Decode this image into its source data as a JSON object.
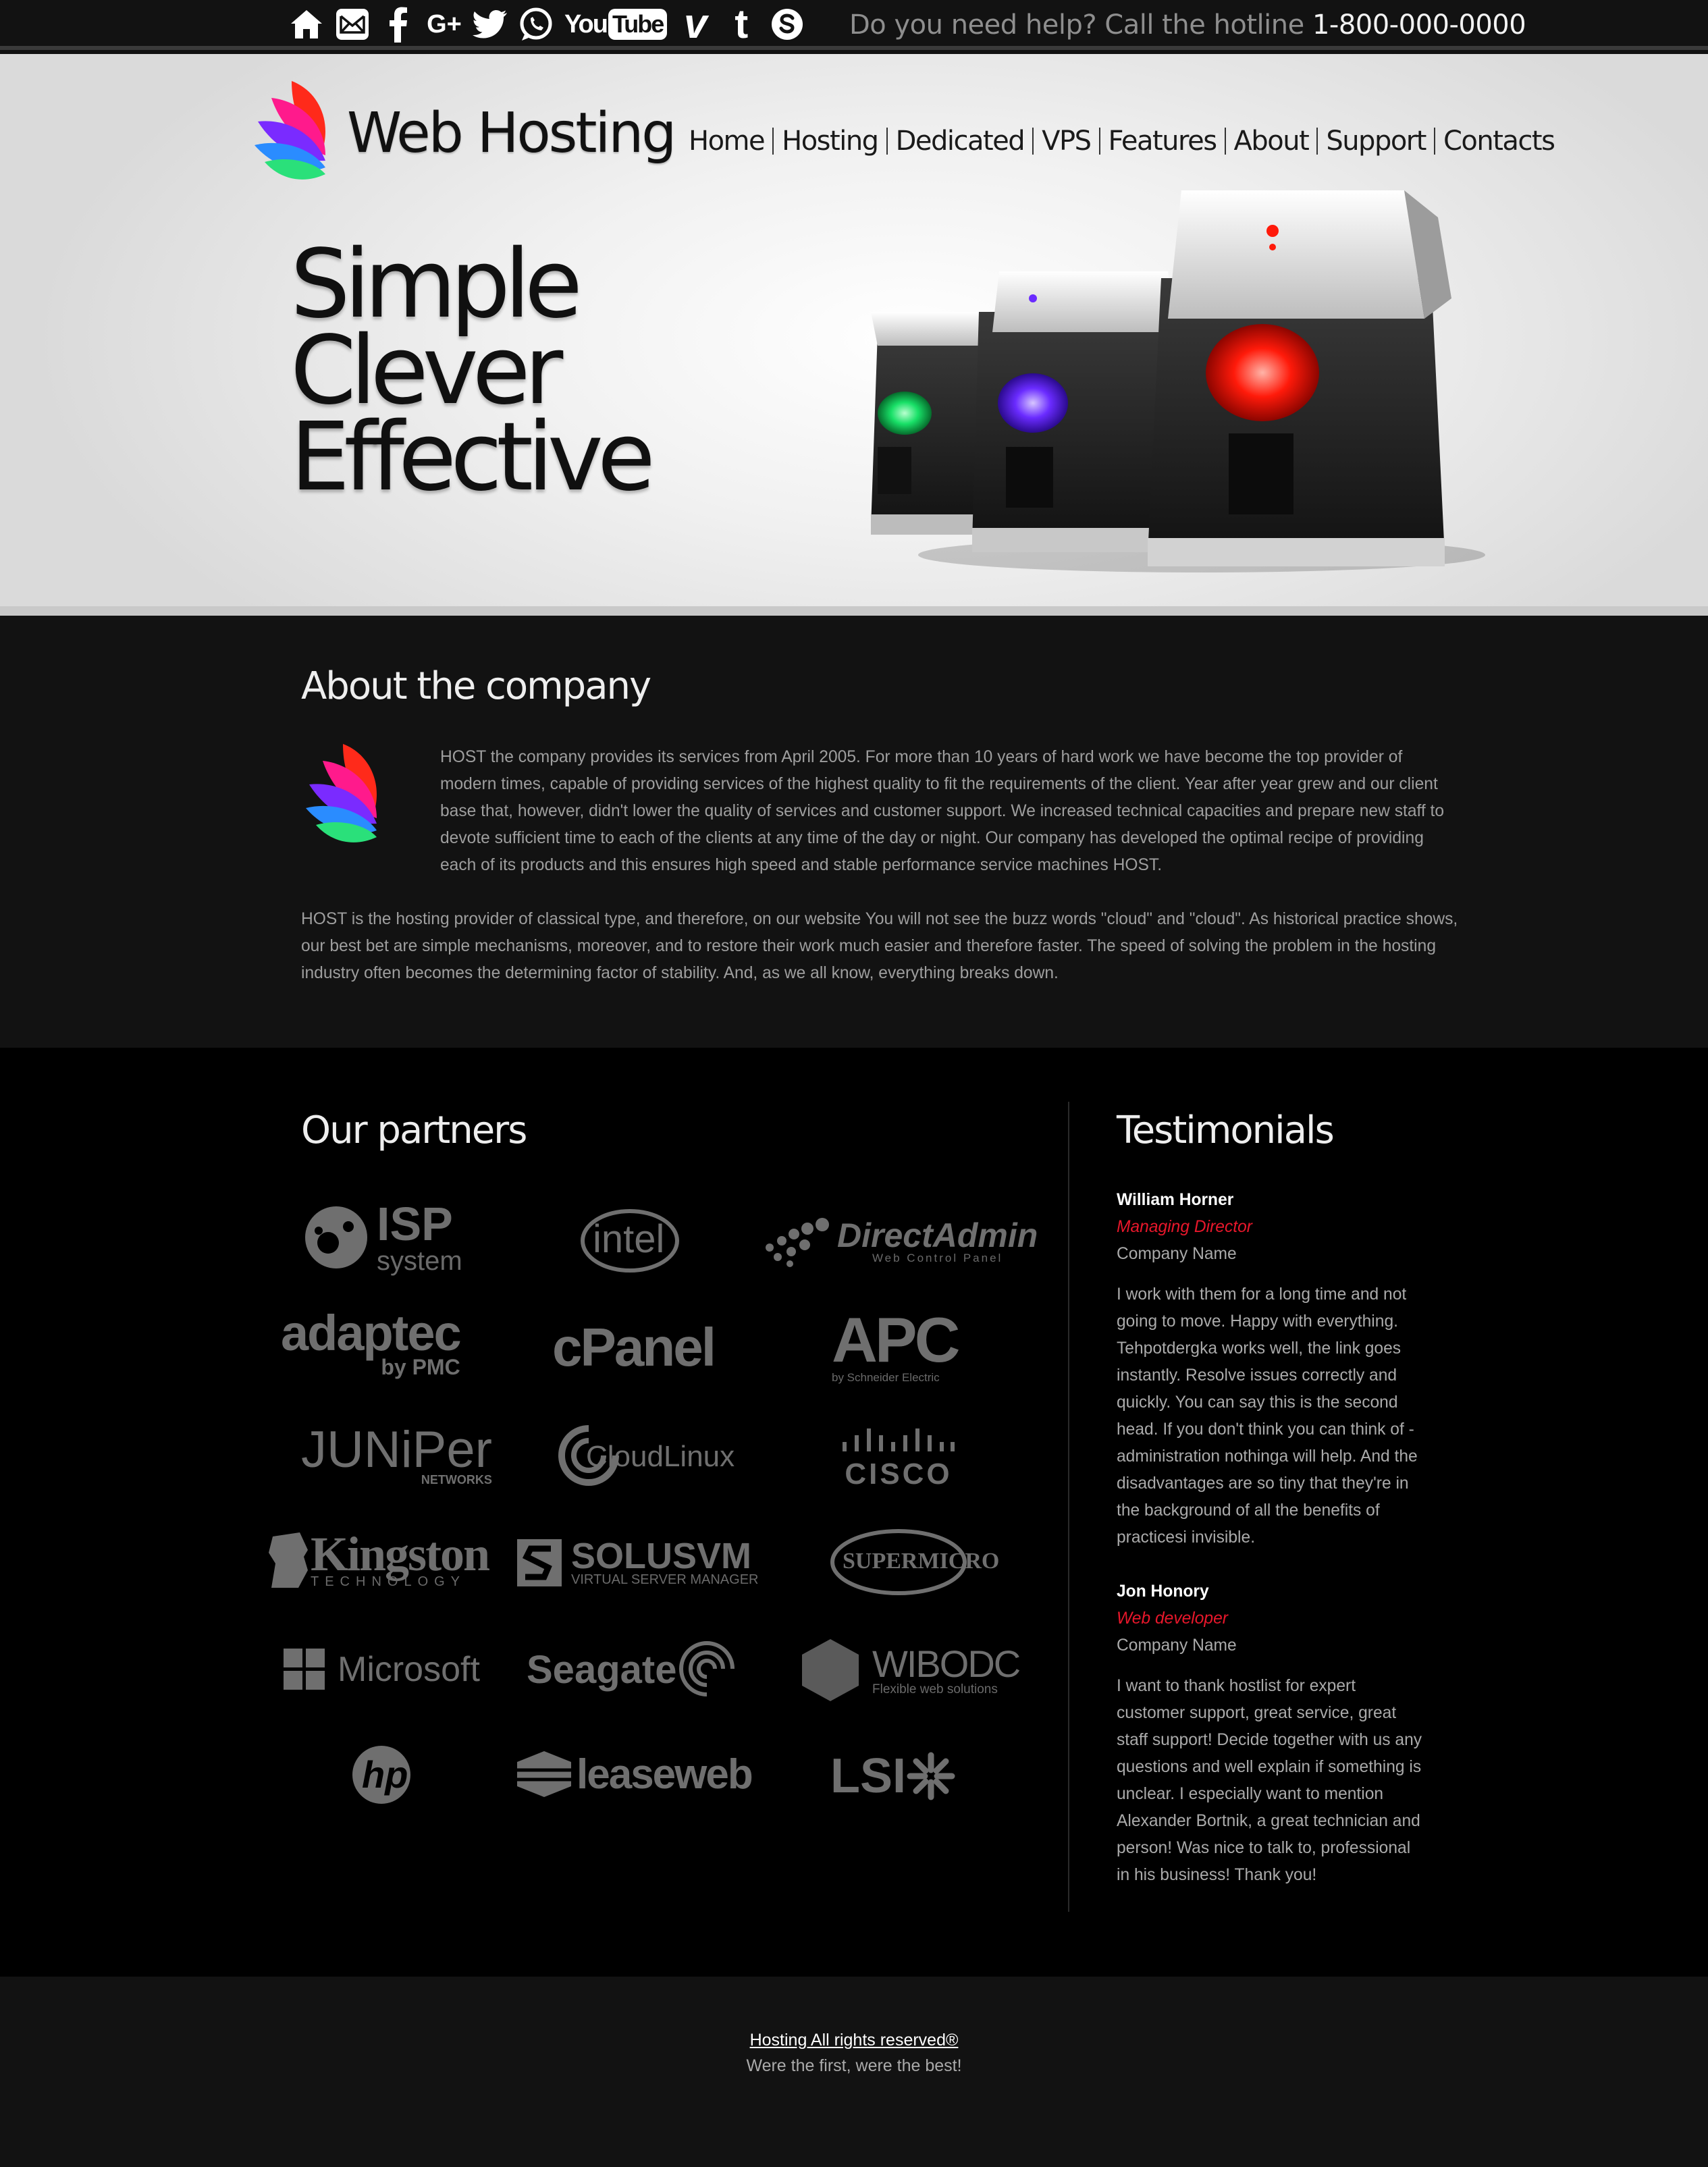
{
  "topbar": {
    "social_icons": [
      "home-icon",
      "mail-icon",
      "facebook-icon",
      "google-plus-icon",
      "twitter-icon",
      "whatsapp-icon",
      "youtube-icon",
      "vimeo-icon",
      "tumblr-icon",
      "skype-icon"
    ],
    "google_plus_label": "G+",
    "youtube_you": "You",
    "youtube_tube": "Tube",
    "vimeo_label": "v",
    "tumblr_label": "t",
    "help_text": "Do you need help? Call the hotline",
    "hotline": "1-800-000-0000"
  },
  "header": {
    "brand": "Web Hosting",
    "nav": [
      "Home",
      "Hosting",
      "Dedicated",
      "VPS",
      "Features",
      "About",
      "Support",
      "Contacts"
    ]
  },
  "hero": {
    "slogan": [
      "Simple",
      "Clever",
      "Effective"
    ]
  },
  "about": {
    "title": "About the company",
    "paragraphs": [
      "HOST the company provides its services from April 2005. For more than 10 years of hard work we have become the top provider of modern times, capable of providing services of the highest quality to fit the requirements of the client. Year after year grew and our client base that, however, didn't lower the quality of services and customer support. We increased technical capacities and prepare new staff to devote sufficient time to each of the clients at any time of the day or night. Our company has developed the optimal recipe of providing each of its products and this ensures high speed and stable performance service machines HOST.",
      "HOST is the hosting provider of classical type, and therefore, on our website You will not see the buzz words \"cloud\" and \"cloud\". As historical practice shows, our best bet are simple mechanisms, moreover, and to restore their work much easier and therefore faster. The speed of solving the problem in the hosting industry often becomes the determining factor of stability. And, as we all know, everything breaks down."
    ]
  },
  "partners": {
    "title": "Our partners",
    "logos": {
      "isp": "ISP",
      "isp_sub": "system",
      "intel": "intel",
      "directadmin": "DirectAdmin",
      "directadmin_sub": "Web Control Panel",
      "adaptec": "adaptec",
      "adaptec_sub": "by PMC",
      "cpanel": "cPanel",
      "apc": "APC",
      "apc_sub": "by Schneider Electric",
      "juniper": "JUNiPer",
      "juniper_sub": "NETWORKS",
      "cloudlinux": "CloudLinux",
      "cisco": "CISCO",
      "kingston": "Kingston",
      "kingston_sub": "TECHNOLOGY",
      "solusvm": "SOLUSVM",
      "solusvm_sub": "VIRTUAL SERVER MANAGER",
      "supermicro": "SUPERMICRO",
      "microsoft": "Microsoft",
      "seagate": "Seagate",
      "wibodc": "WIBODC",
      "wibodc_sub": "Flexible web solutions",
      "hp": "hp",
      "leaseweb": "leaseweb",
      "lsi": "LSI"
    }
  },
  "testimonials": {
    "title": "Testimonials",
    "items": [
      {
        "name": "William Horner",
        "role": "Managing Director",
        "company": "Company Name",
        "quote": "I work with them for a long time and not going to move. Happy with everything. Tehpotdergka works well, the link goes instantly. Resolve issues correctly and quickly. You can say this is the second head. If you don't think you can think of - administration nothinga will help. And the disadvantages are so tiny that they're in the background of all the benefits of practicesi invisible."
      },
      {
        "name": "Jon Honory",
        "role": "Web developer",
        "company": "Company Name",
        "quote": "I want to thank hostlist for expert customer support, great service, great staff support! Decide together with us any questions and well explain if something is unclear. I especially want to mention Alexander Bortnik, a great technician and person! Was nice to talk to, professional in his business! Thank you!"
      }
    ]
  },
  "footer": {
    "copyright": "Hosting All rights reserved®",
    "tagline": "Were the first, were the best!"
  },
  "colors": {
    "accent_red": "#e8172b",
    "dark_bg": "#121212",
    "black_bg": "#000000"
  }
}
